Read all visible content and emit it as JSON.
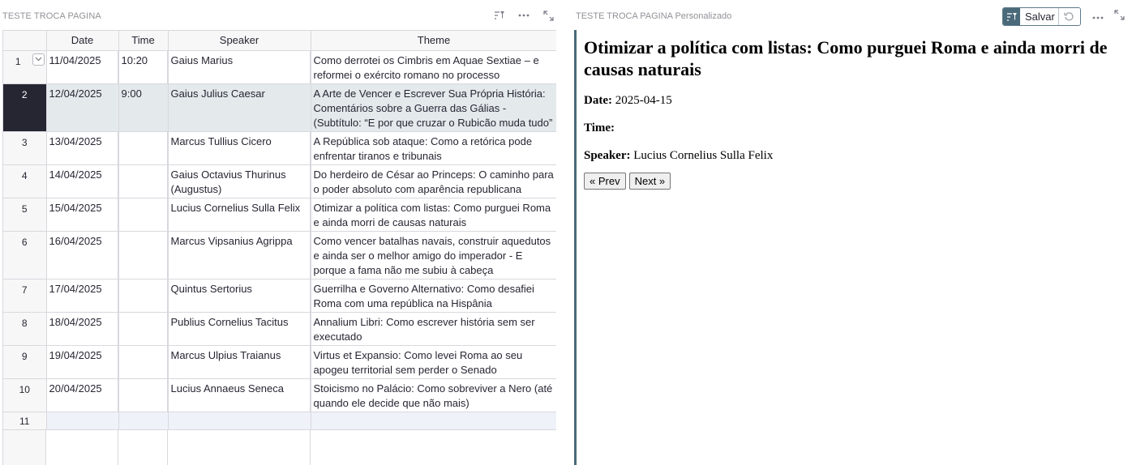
{
  "left": {
    "title": "TESTE TROCA PAGINA",
    "columns": [
      "Date",
      "Time",
      "Speaker",
      "Theme"
    ],
    "rows": [
      {
        "num": "1",
        "date": "11/04/2025",
        "time": "10:20",
        "speaker": "Gaius Marius",
        "theme": "Como derrotei os Cimbris em Aquae Sextiae – e reformei o exército romano no processo"
      },
      {
        "num": "2",
        "date": "12/04/2025",
        "time": "9:00",
        "speaker": "Gaius Julius Caesar",
        "theme": "A Arte de Vencer e Escrever Sua Própria História: Comentários sobre a Guerra das Gálias - (Subtítulo: “E por que cruzar o Rubicão muda tudo”"
      },
      {
        "num": "3",
        "date": "13/04/2025",
        "time": "",
        "speaker": "Marcus Tullius Cicero",
        "theme": "A República sob ataque: Como a retórica pode enfrentar tiranos e tribunais"
      },
      {
        "num": "4",
        "date": "14/04/2025",
        "time": "",
        "speaker": "Gaius Octavius Thurinus (Augustus)",
        "theme": "Do herdeiro de César ao Princeps: O caminho para o poder absoluto com aparência republicana"
      },
      {
        "num": "5",
        "date": "15/04/2025",
        "time": "",
        "speaker": "Lucius Cornelius Sulla Felix",
        "theme": "Otimizar a política com listas: Como purguei Roma e ainda morri de causas naturais"
      },
      {
        "num": "6",
        "date": "16/04/2025",
        "time": "",
        "speaker": "Marcus Vipsanius Agrippa",
        "theme": "Como vencer batalhas navais, construir aquedutos e ainda ser o melhor amigo do imperador - E porque a fama não me subiu à cabeça"
      },
      {
        "num": "7",
        "date": "17/04/2025",
        "time": "",
        "speaker": "Quintus Sertorius",
        "theme": "Guerrilha e Governo Alternativo: Como desafiei Roma com uma república na Hispânia"
      },
      {
        "num": "8",
        "date": "18/04/2025",
        "time": "",
        "speaker": "Publius Cornelius Tacitus",
        "theme": "Annalium Libri: Como escrever história sem ser executado"
      },
      {
        "num": "9",
        "date": "19/04/2025",
        "time": "",
        "speaker": "Marcus Ulpius Traianus",
        "theme": "Virtus et Expansio: Como levei Roma ao seu apogeu territorial sem perder o Senado"
      },
      {
        "num": "10",
        "date": "20/04/2025",
        "time": "",
        "speaker": "Lucius Annaeus Seneca",
        "theme": "Stoicismo no Palácio: Como sobreviver a Nero (até quando ele decide que não mais)"
      }
    ],
    "new_row_num": "11",
    "active_row": "2"
  },
  "right": {
    "title": "TESTE TROCA PAGINA",
    "title_suffix": "Personalizado",
    "save_label": "Salvar",
    "heading": "Otimizar a política com listas: Como purguei Roma e ainda morri de causas naturais",
    "date_label": "Date:",
    "date_value": "2025-04-15",
    "time_label": "Time:",
    "time_value": "",
    "speaker_label": "Speaker:",
    "speaker_value": "Lucius Cornelius Sulla Felix",
    "prev_label": "« Prev",
    "next_label": "Next »"
  },
  "colors": {
    "active_row_bg": "#e4e9ec",
    "active_rownum_bg": "#262633",
    "accent": "#4a6a7a"
  },
  "icons": [
    "filter-sort-icon",
    "more-options-icon",
    "expand-icon",
    "chevron-down-icon",
    "revert-icon"
  ]
}
